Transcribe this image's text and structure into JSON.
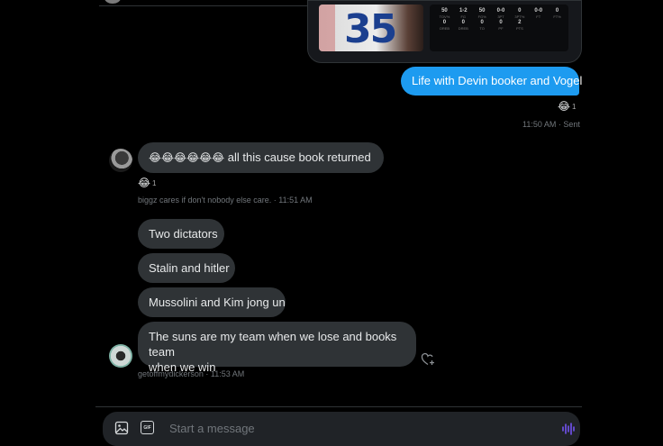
{
  "shared_card": {
    "jersey_number": "35",
    "stat_values": [
      "50",
      "1-2",
      "50",
      "0-0",
      "0",
      "0-0",
      "0"
    ],
    "stat_labels": [
      "TOV%",
      "FG",
      "FG%",
      "3PT",
      "3PT%",
      "FT",
      "FT%"
    ],
    "stat_values_2": [
      "0",
      "0",
      "0",
      "0",
      "2",
      "",
      ""
    ],
    "stat_labels_2": [
      "OREB",
      "DREB",
      "TO",
      "PF",
      "PTS",
      "",
      ""
    ]
  },
  "sent_message": {
    "text": "Life with Devin booker and Vogel",
    "reaction_emoji": "😂",
    "reaction_count": "1",
    "meta": "11:50 AM · Sent"
  },
  "group1": {
    "message_emojis": "😂😂😂😂😂😂",
    "message_text": "all this cause book returned",
    "reaction_emoji": "😂",
    "reaction_count": "1",
    "meta": "biggz cares if don't nobody else care. · 11:51 AM"
  },
  "group2": {
    "messages": [
      "Two dictators",
      "Stalin and hitler",
      "Mussolini and Kim jong un",
      "The suns are my team when we lose and books team",
      "when we win"
    ],
    "meta": "getoffmydickerson · 11:53 AM"
  },
  "composer": {
    "placeholder": "Start a message",
    "gif_label": "GIF"
  },
  "colors": {
    "background": "#000000",
    "sent_bubble": "#1d9bf0",
    "received_bubble": "#2f3336",
    "meta_text": "#71767b",
    "accent_voice": "#7856ff"
  }
}
